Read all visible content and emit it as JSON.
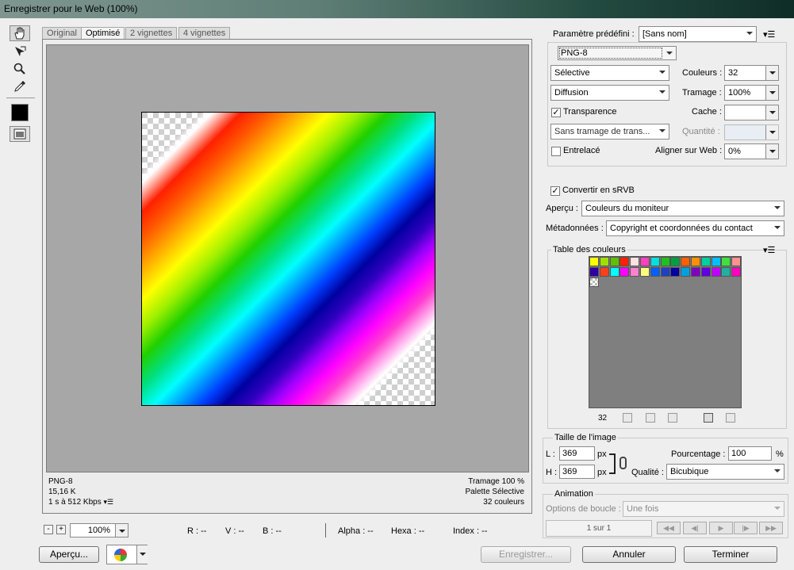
{
  "window": {
    "title": "Enregistrer pour le Web (100%)"
  },
  "tabs": [
    "Original",
    "Optimisé",
    "2 vignettes",
    "4 vignettes"
  ],
  "info": {
    "left": [
      "PNG-8",
      "15,16 K",
      "1 s à 512 Kbps"
    ],
    "right": [
      "Tramage 100 %",
      "Palette Sélective",
      "32 couleurs"
    ]
  },
  "bottom": {
    "zoom": "100%",
    "r": "R : --",
    "v": "V : --",
    "b": "B : --",
    "alpha": "Alpha : --",
    "hexa": "Hexa : --",
    "index": "Index : --",
    "minus": "-",
    "plus": "+"
  },
  "settings": {
    "preset_label": "Paramètre prédéfini :",
    "preset_value": "[Sans nom]",
    "format": "PNG-8",
    "palette": "Sélective",
    "dither": "Diffusion",
    "colors_label": "Couleurs :",
    "colors_value": "32",
    "dither_label": "Tramage :",
    "dither_value": "100%",
    "transparency_label": "Transparence",
    "transparency_checked": "✓",
    "matte_label": "Cache :",
    "transp_dither": "Sans tramage de trans...",
    "amount_label": "Quantité :",
    "interlace_label": "Entrelacé",
    "websnap_label": "Aligner sur Web :",
    "websnap_value": "0%",
    "srgb_label": "Convertir en sRVB",
    "srgb_checked": "✓",
    "preview_label": "Aperçu :",
    "preview_value": "Couleurs du moniteur",
    "metadata_label": "Métadonnées :",
    "metadata_value": "Copyright et coordonnées du contact"
  },
  "colortable": {
    "title": "Table des couleurs",
    "count": "32",
    "swatches": [
      "#ffff00",
      "#a0e000",
      "#60c000",
      "#ff2000",
      "#ffe0e0",
      "#ff40c0",
      "#00e0e0",
      "#20c020",
      "#00a040",
      "#ff6000",
      "#ff9000",
      "#00d0a0",
      "#00c0ff",
      "#40e040",
      "#ff9090",
      "#3000a0",
      "#ff4020",
      "#00ffff",
      "#ff00ff",
      "#ff80d0",
      "#ffff80",
      "#0060ff",
      "#2040c0",
      "#0000a0",
      "#00a0e0",
      "#8000c0",
      "#6000e0",
      "#c000ff",
      "#20b0a0",
      "#ff00c0",
      "transparent"
    ]
  },
  "imagesize": {
    "title": "Taille de l'image",
    "w_label": "L :",
    "w_value": "369",
    "h_label": "H :",
    "h_value": "369",
    "unit": "px",
    "pct_label": "Pourcentage :",
    "pct_value": "100",
    "pct_unit": "%",
    "quality_label": "Qualité :",
    "quality_value": "Bicubique"
  },
  "animation": {
    "title": "Animation",
    "loop_label": "Options de boucle :",
    "loop_value": "Une fois",
    "frame": "1 sur 1"
  },
  "buttons": {
    "preview": "Aperçu...",
    "save": "Enregistrer...",
    "cancel": "Annuler",
    "done": "Terminer"
  },
  "colors": {
    "accent": "#3a8fd8",
    "canvas": "#a7a7a7"
  }
}
